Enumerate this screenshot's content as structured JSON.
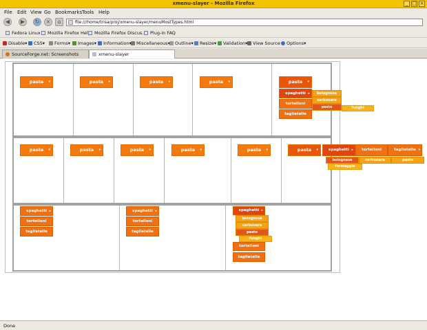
{
  "window": {
    "title": "xmenu-slayer - Mozilla Firefox"
  },
  "menu": [
    "File",
    "Edit",
    "View",
    "Go",
    "Bookmarks",
    "Tools",
    "Help"
  ],
  "nav": {
    "url": "file:///home/trisa/proj/xmenu-slayer/menuMostTypes.html"
  },
  "bookmarks": [
    "Fedora Linux",
    "Mozilla Firefox Help",
    "Mozilla Firefox Discus...",
    "Plug-in FAQ"
  ],
  "devtoolbar": [
    "Disable",
    "CSS",
    "Forms",
    "Images",
    "Information",
    "Miscellaneous",
    "Outline",
    "Resize",
    "Validation",
    "View Source",
    "Options"
  ],
  "tabs": [
    "SourceForge.net: Screenshots",
    "xmenu-slayer"
  ],
  "status": "Done",
  "menu_labels": {
    "pasta": "pasta",
    "spaghetti": "spaghetti",
    "tortelloni": "tortelloni",
    "tagliatelle": "tagliatelle",
    "bolognese": "bolognese",
    "carbonara": "carbonara",
    "pesto": "pesto",
    "funghi": "funghi",
    "formaggio": "formaggio"
  },
  "colors": {
    "menu_orange": "#f47a10",
    "menu_dark": "#e8560a",
    "submenu_yellow": "#f6a316",
    "titlebar": "#f2c400"
  }
}
